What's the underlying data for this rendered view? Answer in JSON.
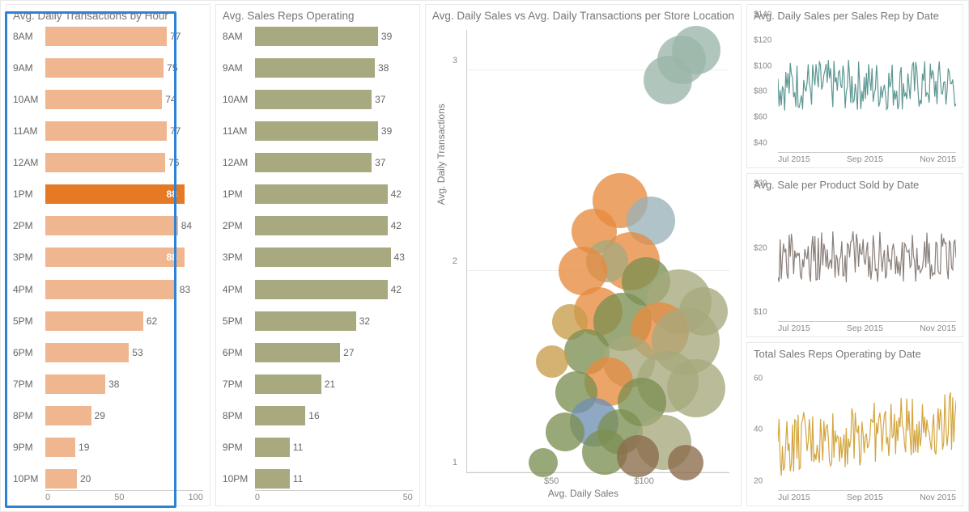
{
  "chart_data": [
    {
      "id": "transactions_by_hour",
      "type": "bar",
      "orientation": "horizontal",
      "title": "Avg. Daily Transactions by Hour",
      "categories": [
        "8AM",
        "9AM",
        "10AM",
        "11AM",
        "12AM",
        "1PM",
        "2PM",
        "3PM",
        "4PM",
        "5PM",
        "6PM",
        "7PM",
        "8PM",
        "9PM",
        "10PM"
      ],
      "values": [
        77,
        75,
        74,
        77,
        76,
        88,
        84,
        88,
        83,
        62,
        53,
        38,
        29,
        19,
        20
      ],
      "highlight_index": 5,
      "secondary_highlight_index": 7,
      "xlim": [
        0,
        100
      ],
      "xticks": [
        0,
        50,
        100
      ],
      "bar_color": "#f0b68f",
      "highlight_color": "#e67a24"
    },
    {
      "id": "sales_reps_operating",
      "type": "bar",
      "orientation": "horizontal",
      "title": "Avg. Sales Reps Operating",
      "categories": [
        "8AM",
        "9AM",
        "10AM",
        "11AM",
        "12AM",
        "1PM",
        "2PM",
        "3PM",
        "4PM",
        "5PM",
        "6PM",
        "7PM",
        "8PM",
        "9PM",
        "10PM"
      ],
      "values": [
        39,
        38,
        37,
        39,
        37,
        42,
        42,
        43,
        42,
        32,
        27,
        21,
        16,
        11,
        11
      ],
      "xlim": [
        0,
        50
      ],
      "xticks": [
        0,
        50
      ],
      "bar_color": "#a8a97e"
    },
    {
      "id": "sales_vs_transactions_scatter",
      "type": "scatter",
      "title": "Avg. Daily Sales vs Avg. Daily Transactions per Store Location",
      "xlabel": "Avg. Daily Sales",
      "ylabel": "Avg. Daily Transactions",
      "xlim": [
        0,
        120
      ],
      "ylim": [
        1,
        3.2
      ],
      "xticks_labels": [
        "$50",
        "$100"
      ],
      "xticks_values": [
        50,
        100
      ],
      "yticks": [
        1,
        2,
        3
      ],
      "bubbles": [
        {
          "x": 105,
          "y": 3.1,
          "r": 30,
          "c": "#9ab6a9"
        },
        {
          "x": 98,
          "y": 3.05,
          "r": 30,
          "c": "#9ab6a9"
        },
        {
          "x": 92,
          "y": 2.95,
          "r": 30,
          "c": "#9ab6a9"
        },
        {
          "x": 70,
          "y": 2.35,
          "r": 34,
          "c": "#e78b3f"
        },
        {
          "x": 84,
          "y": 2.25,
          "r": 30,
          "c": "#99b2b8"
        },
        {
          "x": 58,
          "y": 2.2,
          "r": 28,
          "c": "#e78b3f"
        },
        {
          "x": 75,
          "y": 2.05,
          "r": 36,
          "c": "#e78b3f"
        },
        {
          "x": 64,
          "y": 2.05,
          "r": 26,
          "c": "#a7a97c"
        },
        {
          "x": 53,
          "y": 2.0,
          "r": 30,
          "c": "#e78b3f"
        },
        {
          "x": 82,
          "y": 1.95,
          "r": 30,
          "c": "#7c8f52"
        },
        {
          "x": 97,
          "y": 1.85,
          "r": 40,
          "c": "#a7a97c"
        },
        {
          "x": 108,
          "y": 1.8,
          "r": 30,
          "c": "#a7a97c"
        },
        {
          "x": 60,
          "y": 1.8,
          "r": 30,
          "c": "#e78b3f"
        },
        {
          "x": 71,
          "y": 1.75,
          "r": 36,
          "c": "#7c8f52"
        },
        {
          "x": 47,
          "y": 1.75,
          "r": 22,
          "c": "#c69c4a"
        },
        {
          "x": 88,
          "y": 1.7,
          "r": 36,
          "c": "#e78b3f"
        },
        {
          "x": 100,
          "y": 1.65,
          "r": 42,
          "c": "#a7a97c"
        },
        {
          "x": 55,
          "y": 1.6,
          "r": 28,
          "c": "#7c8f52"
        },
        {
          "x": 74,
          "y": 1.55,
          "r": 32,
          "c": "#a7a97c"
        },
        {
          "x": 39,
          "y": 1.55,
          "r": 20,
          "c": "#c69c4a"
        },
        {
          "x": 65,
          "y": 1.45,
          "r": 30,
          "c": "#e78b3f"
        },
        {
          "x": 92,
          "y": 1.45,
          "r": 38,
          "c": "#a7a97c"
        },
        {
          "x": 105,
          "y": 1.42,
          "r": 36,
          "c": "#a7a97c"
        },
        {
          "x": 50,
          "y": 1.4,
          "r": 26,
          "c": "#7c8f52"
        },
        {
          "x": 80,
          "y": 1.35,
          "r": 30,
          "c": "#7c8f52"
        },
        {
          "x": 58,
          "y": 1.25,
          "r": 30,
          "c": "#6f8fb2"
        },
        {
          "x": 70,
          "y": 1.2,
          "r": 28,
          "c": "#7c8f52"
        },
        {
          "x": 45,
          "y": 1.2,
          "r": 24,
          "c": "#7c8f52"
        },
        {
          "x": 90,
          "y": 1.15,
          "r": 34,
          "c": "#a7a97c"
        },
        {
          "x": 63,
          "y": 1.1,
          "r": 28,
          "c": "#7c8f52"
        },
        {
          "x": 78,
          "y": 1.08,
          "r": 26,
          "c": "#8a6b4a"
        },
        {
          "x": 100,
          "y": 1.05,
          "r": 22,
          "c": "#8a6b4a"
        },
        {
          "x": 35,
          "y": 1.05,
          "r": 18,
          "c": "#7c8f52"
        }
      ]
    },
    {
      "id": "daily_sales_per_rep",
      "type": "line",
      "title": "Avg. Daily Sales per Sales Rep by Date",
      "ylim": [
        40,
        140
      ],
      "yticks": [
        "$40",
        "$60",
        "$80",
        "$100",
        "$120",
        "$140"
      ],
      "xticks": [
        "Jul 2015",
        "Sep 2015",
        "Nov 2015"
      ],
      "color": "#5d9893",
      "series_mean": 92,
      "series_noise": 20
    },
    {
      "id": "sale_per_product",
      "type": "line",
      "title": "Avg. Sale per Product Sold by Date",
      "ylim": [
        10,
        30
      ],
      "yticks": [
        "$10",
        "$20",
        "$30"
      ],
      "xticks": [
        "Jul 2015",
        "Sep 2015",
        "Nov 2015"
      ],
      "color": "#8a7f7a",
      "series_mean": 20,
      "series_noise": 4
    },
    {
      "id": "total_reps_operating",
      "type": "line",
      "title": "Total Sales Reps Operating by Date",
      "ylim": [
        20,
        70
      ],
      "yticks": [
        "20",
        "40",
        "60"
      ],
      "xticks": [
        "Jul 2015",
        "Sep 2015",
        "Nov 2015"
      ],
      "color": "#d3a53f",
      "series_mean": 42,
      "series_noise": 12,
      "trend": 0.12
    }
  ],
  "selection": {
    "chart_id": "transactions_by_hour"
  }
}
